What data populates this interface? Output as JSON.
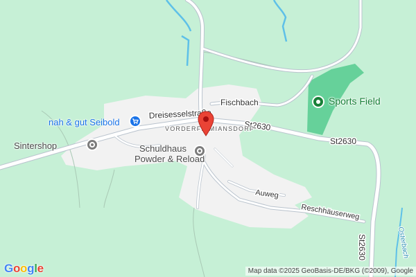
{
  "map": {
    "colors": {
      "background": "#c6f0d6",
      "settlement": "#f2f2f2",
      "sports_field": "#66d19a",
      "road": "#ffffff",
      "road_casing": "#b9c3cd",
      "water": "#5ec0e8",
      "marker": "#ea4335"
    },
    "district": "VORDERFIRMIANSDORF",
    "pois": {
      "nah_gut": {
        "label": "nah & gut Seibold",
        "icon": "shopping-cart-icon"
      },
      "sintershop": {
        "label": "Sintershop",
        "icon": "shop-icon"
      },
      "schuldhaus": {
        "line1": "Schuldhaus",
        "line2": "Powder & Reload",
        "icon": "shop-icon"
      },
      "sports_field": {
        "label": "Sports Field",
        "icon": "sports-field-icon"
      }
    },
    "roads": {
      "dreisessel": "Dreisesselstraße",
      "fischbach": "Fischbach",
      "st2630_a": "St2630",
      "st2630_b": "St2630",
      "st2630_c": "St2630",
      "auweg": "Auweg",
      "reschhaeuser": "Reschhäuserweg"
    },
    "water": {
      "osterbach": "Osterbach"
    },
    "marker": {
      "icon": "location-pin-icon"
    },
    "branding": {
      "logo": "Google"
    },
    "attribution": "Map data ©2025 GeoBasis-DE/BKG (©2009), Google"
  }
}
